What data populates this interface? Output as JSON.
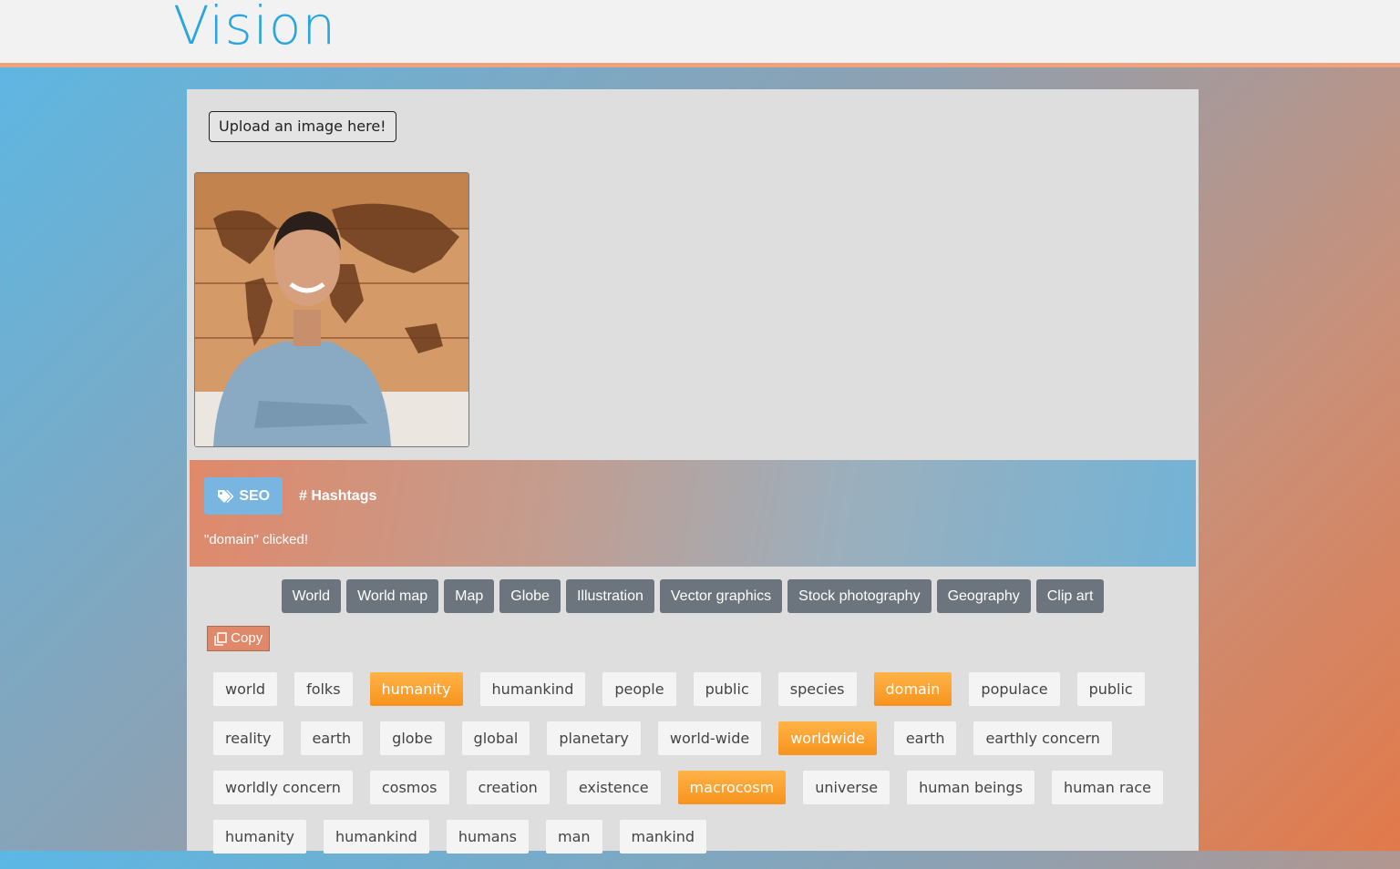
{
  "app": {
    "title": "Vision"
  },
  "upload": {
    "label": "Upload an image here!"
  },
  "tabs": {
    "seo_label": "SEO",
    "hashtags_label": "# Hashtags"
  },
  "status": {
    "message": "\"domain\" clicked!"
  },
  "labels": [
    "World",
    "World map",
    "Map",
    "Globe",
    "Illustration",
    "Vector graphics",
    "Stock photography",
    "Geography",
    "Clip art"
  ],
  "copy": {
    "label": "Copy"
  },
  "tags": [
    {
      "text": "world",
      "active": false
    },
    {
      "text": "folks",
      "active": false
    },
    {
      "text": "humanity",
      "active": true
    },
    {
      "text": "humankind",
      "active": false
    },
    {
      "text": "people",
      "active": false
    },
    {
      "text": "public",
      "active": false
    },
    {
      "text": "species",
      "active": false
    },
    {
      "text": "domain",
      "active": true
    },
    {
      "text": "populace",
      "active": false
    },
    {
      "text": "public",
      "active": false
    },
    {
      "text": "reality",
      "active": false
    },
    {
      "text": "earth",
      "active": false
    },
    {
      "text": "globe",
      "active": false
    },
    {
      "text": "global",
      "active": false
    },
    {
      "text": "planetary",
      "active": false
    },
    {
      "text": "world-wide",
      "active": false
    },
    {
      "text": "worldwide",
      "active": true
    },
    {
      "text": "earth",
      "active": false
    },
    {
      "text": "earthly concern",
      "active": false
    },
    {
      "text": "worldly concern",
      "active": false
    },
    {
      "text": "cosmos",
      "active": false
    },
    {
      "text": "creation",
      "active": false
    },
    {
      "text": "existence",
      "active": false
    },
    {
      "text": "macrocosm",
      "active": true
    },
    {
      "text": "universe",
      "active": false
    },
    {
      "text": "human beings",
      "active": false
    },
    {
      "text": "human race",
      "active": false
    },
    {
      "text": "humanity",
      "active": false
    },
    {
      "text": "humankind",
      "active": false
    },
    {
      "text": "humans",
      "active": false
    },
    {
      "text": "man",
      "active": false
    },
    {
      "text": "mankind",
      "active": false
    }
  ],
  "colors": {
    "accent": "#2aa5de",
    "label_bg": "#6c757d",
    "tag_active": "#f7931e",
    "copy_bg": "#e0896a"
  },
  "icons": {
    "seo": "tags-icon",
    "copy": "copy-icon"
  }
}
